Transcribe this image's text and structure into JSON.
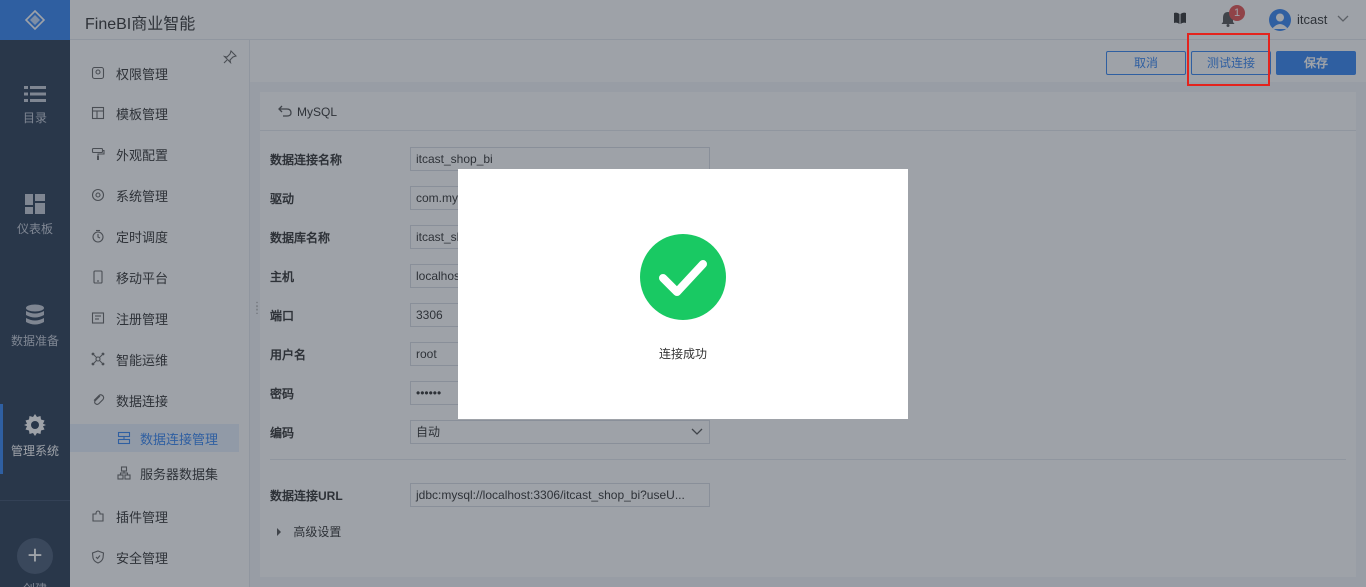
{
  "rail": {
    "items": [
      {
        "label": "目录",
        "icon": "list-icon"
      },
      {
        "label": "仪表板",
        "icon": "dashboard-icon"
      },
      {
        "label": "数据准备",
        "icon": "database-icon"
      },
      {
        "label": "管理系统",
        "icon": "gear-icon"
      }
    ],
    "create_label": "创建"
  },
  "header": {
    "title": "FineBI商业智能",
    "notification_count": "1",
    "username": "itcast"
  },
  "subnav": {
    "items": [
      {
        "label": "权限管理",
        "icon": "permission-icon"
      },
      {
        "label": "模板管理",
        "icon": "template-icon"
      },
      {
        "label": "外观配置",
        "icon": "paint-roller-icon"
      },
      {
        "label": "系统管理",
        "icon": "settings-icon"
      },
      {
        "label": "定时调度",
        "icon": "timer-icon"
      },
      {
        "label": "移动平台",
        "icon": "mobile-icon"
      },
      {
        "label": "注册管理",
        "icon": "register-icon"
      },
      {
        "label": "智能运维",
        "icon": "operations-icon"
      },
      {
        "label": "数据连接",
        "icon": "link-icon"
      }
    ],
    "sub_items": [
      {
        "label": "数据连接管理",
        "icon": "data-connection-icon",
        "active": true
      },
      {
        "label": "服务器数据集",
        "icon": "server-dataset-icon",
        "active": false
      }
    ],
    "bottom_items": [
      {
        "label": "插件管理",
        "icon": "plugin-icon"
      },
      {
        "label": "安全管理",
        "icon": "shield-icon"
      }
    ]
  },
  "toolbar": {
    "cancel_label": "取消",
    "test_label": "测试连接",
    "save_label": "保存"
  },
  "form": {
    "back_title": "MySQL",
    "fields": [
      {
        "label": "数据连接名称",
        "value": "itcast_shop_bi"
      },
      {
        "label": "驱动",
        "value": "com.mysql.jdbc.Driver"
      },
      {
        "label": "数据库名称",
        "value": "itcast_shop_bi"
      },
      {
        "label": "主机",
        "value": "localhost"
      },
      {
        "label": "端口",
        "value": "3306"
      },
      {
        "label": "用户名",
        "value": "root"
      },
      {
        "label": "密码",
        "value": "••••••"
      },
      {
        "label": "编码",
        "value": "自动"
      }
    ],
    "url_label": "数据连接URL",
    "url_value": "jdbc:mysql://localhost:3306/itcast_shop_bi?useU...",
    "advanced_label": "高级设置"
  },
  "modal": {
    "message": "连接成功",
    "icon": "success-check-icon",
    "color": "#19c963"
  },
  "colors": {
    "accent": "#3685f2",
    "rail_bg": "#2b3c55",
    "highlight": "#e4231d"
  }
}
